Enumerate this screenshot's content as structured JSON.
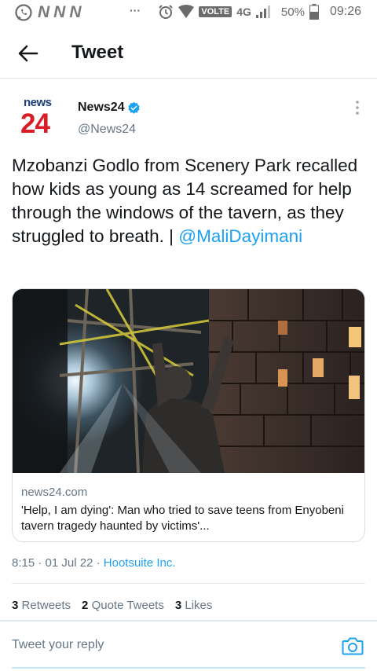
{
  "status_bar": {
    "carriers": [
      "N",
      "N",
      "N"
    ],
    "dots": "···",
    "volte": "VOLTE",
    "network": "4G",
    "battery": "50%",
    "time": "09:26",
    "icons": [
      "whatsapp-icon",
      "alarm-icon",
      "wifi-icon",
      "signal-icon",
      "battery-icon"
    ]
  },
  "header": {
    "title": "Tweet",
    "back_icon": "arrow-left-icon"
  },
  "tweet": {
    "logo_top": "news",
    "logo_bottom": "24",
    "author_name": "News24",
    "author_handle": "@News24",
    "verified": true,
    "text": "Mzobanzi Godlo from Scenery Park recalled how kids as young as 14 screamed for help through the windows of the tavern, as they struggled to breath. | ",
    "mention": "@MaliDayimani",
    "card": {
      "domain": "news24.com",
      "title": "'Help, I am dying': Man who tried to save teens from Enyobeni tavern tragedy haunted by victims'..."
    },
    "time": "8:15",
    "date": "01 Jul 22",
    "source": "Hootsuite Inc.",
    "stats": {
      "retweets_count": "3",
      "retweets_label": "Retweets",
      "quotes_count": "2",
      "quotes_label": "Quote Tweets",
      "likes_count": "3",
      "likes_label": "Likes"
    }
  },
  "reply": {
    "placeholder": "Tweet your reply",
    "camera_icon": "camera-icon"
  },
  "colors": {
    "accent": "#1da1f2",
    "text": "#14171a",
    "secondary": "#657786",
    "logo_blue": "#1b3d7a",
    "logo_red": "#d91d26"
  }
}
